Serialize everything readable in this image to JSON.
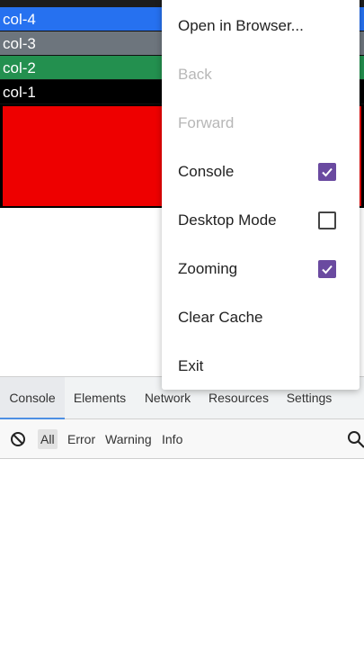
{
  "page": {
    "rows": [
      {
        "label": "col-4",
        "color": "#2671f0"
      },
      {
        "label": "col-3",
        "color": "#6d757d"
      },
      {
        "label": "col-2",
        "color": "#23904f"
      },
      {
        "label": "col-1",
        "color": "#000000"
      }
    ],
    "red_block_color": "#ee0000"
  },
  "menu": {
    "items": [
      {
        "label": "Open in Browser...",
        "enabled": true
      },
      {
        "label": "Back",
        "enabled": false
      },
      {
        "label": "Forward",
        "enabled": false
      },
      {
        "label": "Console",
        "enabled": true,
        "checkbox": true,
        "checked": true
      },
      {
        "label": "Desktop Mode",
        "enabled": true,
        "checkbox": true,
        "checked": false
      },
      {
        "label": "Zooming",
        "enabled": true,
        "checkbox": true,
        "checked": true
      },
      {
        "label": "Clear Cache",
        "enabled": true
      },
      {
        "label": "Exit",
        "enabled": true
      }
    ],
    "accent_color": "#6a4aa0"
  },
  "devtools": {
    "tabs": [
      {
        "label": "Console",
        "active": true
      },
      {
        "label": "Elements",
        "active": false
      },
      {
        "label": "Network",
        "active": false
      },
      {
        "label": "Resources",
        "active": false
      },
      {
        "label": "Settings",
        "active": false
      }
    ],
    "filters": [
      {
        "label": "All",
        "selected": true
      },
      {
        "label": "Error",
        "selected": false
      },
      {
        "label": "Warning",
        "selected": false
      },
      {
        "label": "Info",
        "selected": false
      }
    ],
    "clear_icon": "block-icon",
    "search_icon": "search-icon"
  }
}
